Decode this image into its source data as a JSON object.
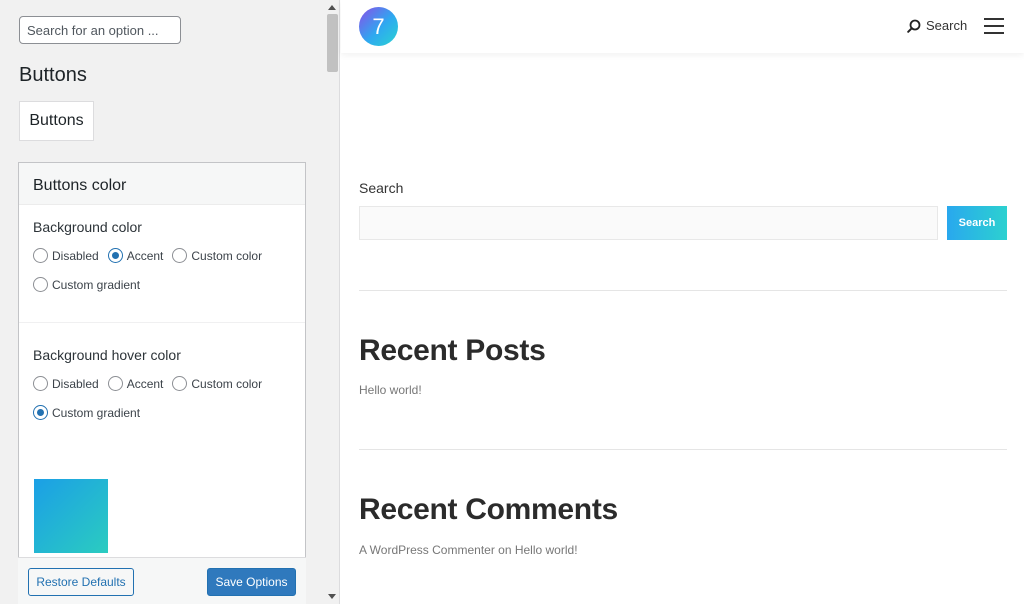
{
  "panel": {
    "search_placeholder": "Search for an option ...",
    "section_title": "Buttons",
    "section_button": "Buttons",
    "card": {
      "title": "Buttons color",
      "background": {
        "label": "Background color",
        "options": [
          "Disabled",
          "Accent",
          "Custom color",
          "Custom gradient"
        ],
        "selected": "Accent"
      },
      "hover": {
        "label": "Background hover color",
        "options": [
          "Disabled",
          "Accent",
          "Custom color",
          "Custom gradient"
        ],
        "selected": "Custom gradient"
      },
      "gradient_colors": [
        "#1b9fe6",
        "#2bccc0"
      ]
    },
    "footer": {
      "restore_label": "Restore Defaults",
      "save_label": "Save Options"
    }
  },
  "preview": {
    "logo_text": "7",
    "header_search_label": "Search",
    "search_widget": {
      "label": "Search",
      "button_label": "Search"
    },
    "recent_posts": {
      "title": "Recent Posts",
      "item": "Hello world!"
    },
    "recent_comments": {
      "title": "Recent Comments",
      "item": "A WordPress Commenter on Hello world!"
    }
  },
  "colors": {
    "accent": "#2271b1",
    "button_gradient_start": "#29a8ee",
    "button_gradient_end": "#2cd1d0"
  },
  "icons": [
    "search-icon",
    "menu-icon",
    "site-logo"
  ]
}
